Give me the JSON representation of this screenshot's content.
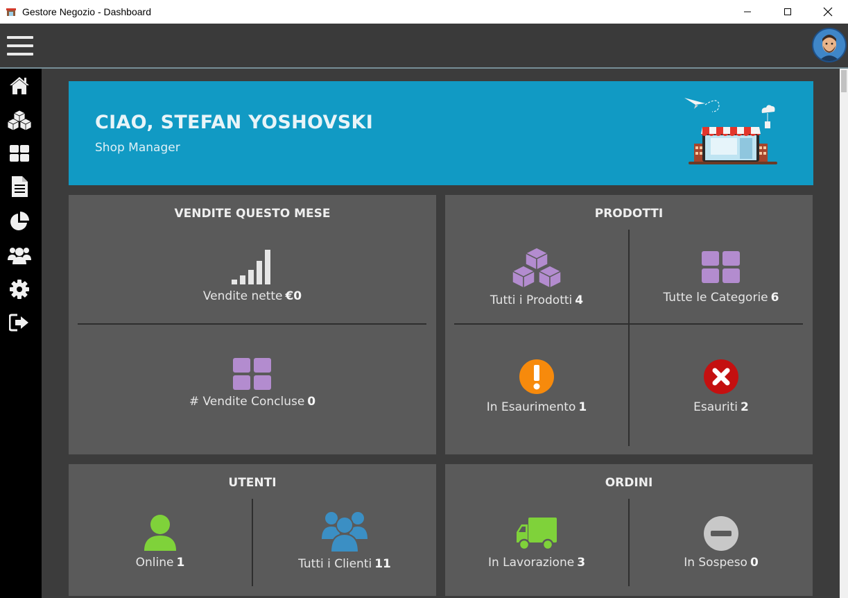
{
  "window": {
    "title": "Gestore Negozio - Dashboard"
  },
  "sidebar": {
    "items": [
      {
        "icon": "home-icon"
      },
      {
        "icon": "products-icon"
      },
      {
        "icon": "categories-icon"
      },
      {
        "icon": "document-icon"
      },
      {
        "icon": "pie-chart-icon"
      },
      {
        "icon": "users-icon"
      },
      {
        "icon": "settings-icon"
      },
      {
        "icon": "logout-icon"
      }
    ]
  },
  "banner": {
    "greeting": "CIAO, STEFAN YOSHOVSKI",
    "role": "Shop Manager"
  },
  "sales": {
    "title": "VENDITE QUESTO MESE",
    "net_label": "Vendite nette",
    "net_value": "€0",
    "closed_label": "# Vendite Concluse",
    "closed_value": "0"
  },
  "products": {
    "title": "PRODOTTI",
    "all_label": "Tutti i Prodotti",
    "all_value": "4",
    "categories_label": "Tutte le Categorie",
    "categories_value": "6",
    "low_label": "In Esaurimento",
    "low_value": "1",
    "out_label": "Esauriti",
    "out_value": "2"
  },
  "users": {
    "title": "UTENTI",
    "online_label": "Online",
    "online_value": "1",
    "clients_label": "Tutti i Clienti",
    "clients_value": "11"
  },
  "orders": {
    "title": "ORDINI",
    "processing_label": "In Lavorazione",
    "processing_value": "3",
    "pending_label": "In Sospeso",
    "pending_value": "0"
  },
  "colors": {
    "accent": "#119ac4",
    "purple": "#b38ccf",
    "orange": "#f78a0c",
    "red": "#c41010",
    "green": "#7fd23a",
    "blue": "#3b8fc4",
    "grey": "#c8c8c8"
  }
}
